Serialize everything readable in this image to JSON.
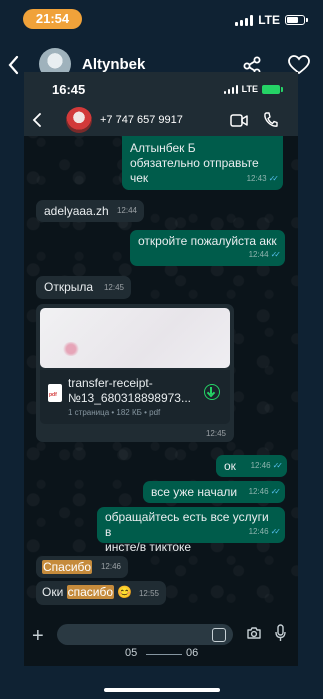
{
  "outer_status": {
    "time": "21:54",
    "network": "LTE"
  },
  "outer_header": {
    "contact_name": "Altynbek"
  },
  "inner_status": {
    "time": "16:45",
    "network": "LTE"
  },
  "chat_header": {
    "contact": "+7 747 657 9917"
  },
  "messages": [
    {
      "id": "m1",
      "direction": "out",
      "text_line1": "Алтынбек Б",
      "text_line2": "обязательно отправьте чек",
      "time": "12:43"
    },
    {
      "id": "m2",
      "direction": "in",
      "text": "adelyaaa.zh",
      "time": "12:44"
    },
    {
      "id": "m3",
      "direction": "out",
      "text": "откройте пожалуйста акк",
      "time": "12:44"
    },
    {
      "id": "m4",
      "direction": "in",
      "text": "Открыла",
      "time": "12:45"
    },
    {
      "id": "m6",
      "direction": "out",
      "text": "ок",
      "time": "12:46"
    },
    {
      "id": "m7",
      "direction": "out",
      "text": "все уже начали",
      "time": "12:46"
    },
    {
      "id": "m8",
      "direction": "out",
      "text_line1": "обращайтесь есть все услуги в",
      "text_line2": "инсте/в тиктоке",
      "time": "12:46"
    },
    {
      "id": "m9",
      "direction": "in",
      "text": "Спасибо",
      "time": "12:46"
    },
    {
      "id": "m10",
      "direction": "in",
      "text_prefix": "Оки ",
      "text_highlight": "спасибо",
      "emoji": "😊",
      "time": "12:55"
    }
  ],
  "attachment": {
    "file_name_line1": "transfer-receipt-",
    "file_name_line2": "№13_680318898973...",
    "file_info": "1 страница • 182 КБ • pdf",
    "file_type": "pdf",
    "time": "12:45"
  },
  "nav": {
    "left_time": "05",
    "right_time": "06"
  },
  "colors": {
    "outgoing_bubble": "#005c4b",
    "incoming_bubble": "#202c33",
    "read_ticks": "#53bdeb",
    "time_pill": "#f0a23a",
    "highlight": "#c58b3c"
  }
}
